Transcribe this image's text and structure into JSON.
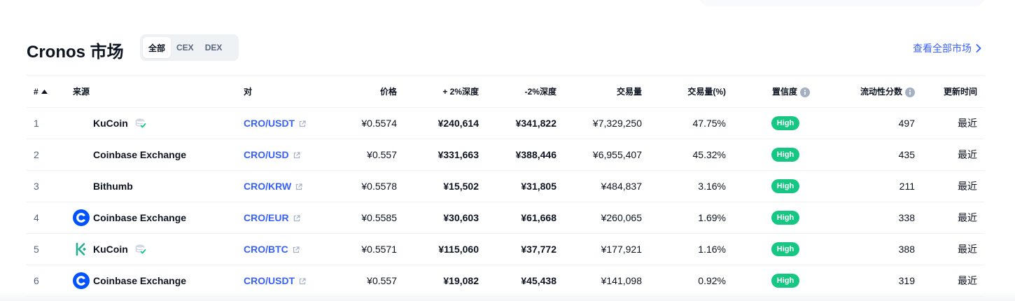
{
  "header": {
    "title": "Cronos 市场",
    "filters": [
      {
        "label": "全部",
        "active": true
      },
      {
        "label": "CEX",
        "active": false
      },
      {
        "label": "DEX",
        "active": false
      }
    ],
    "view_all": "查看全部市场"
  },
  "table": {
    "columns": {
      "rank": "#",
      "source": "来源",
      "pair": "对",
      "price": "价格",
      "depth_plus": "+ 2%深度",
      "depth_minus": "-2%深度",
      "volume": "交易量",
      "volume_pct": "交易量(%)",
      "confidence": "置信度",
      "liquidity": "流动性分数",
      "updated": "更新时间"
    },
    "rows": [
      {
        "rank": "1",
        "source": "KuCoin",
        "logo": "none",
        "verified": true,
        "pair": "CRO/USDT",
        "price": "¥0.5574",
        "depth_plus": "¥240,614",
        "depth_minus": "¥341,822",
        "volume": "¥7,329,250",
        "volume_pct": "47.75%",
        "confidence": "High",
        "liquidity": "497",
        "updated": "最近"
      },
      {
        "rank": "2",
        "source": "Coinbase Exchange",
        "logo": "none",
        "verified": false,
        "pair": "CRO/USD",
        "price": "¥0.557",
        "depth_plus": "¥331,663",
        "depth_minus": "¥388,446",
        "volume": "¥6,955,407",
        "volume_pct": "45.32%",
        "confidence": "High",
        "liquidity": "435",
        "updated": "最近"
      },
      {
        "rank": "3",
        "source": "Bithumb",
        "logo": "none",
        "verified": false,
        "pair": "CRO/KRW",
        "price": "¥0.5578",
        "depth_plus": "¥15,502",
        "depth_minus": "¥31,805",
        "volume": "¥484,837",
        "volume_pct": "3.16%",
        "confidence": "High",
        "liquidity": "211",
        "updated": "最近"
      },
      {
        "rank": "4",
        "source": "Coinbase Exchange",
        "logo": "coinbase",
        "verified": false,
        "pair": "CRO/EUR",
        "price": "¥0.5585",
        "depth_plus": "¥30,603",
        "depth_minus": "¥61,668",
        "volume": "¥260,065",
        "volume_pct": "1.69%",
        "confidence": "High",
        "liquidity": "338",
        "updated": "最近"
      },
      {
        "rank": "5",
        "source": "KuCoin",
        "logo": "kucoin",
        "verified": true,
        "pair": "CRO/BTC",
        "price": "¥0.5571",
        "depth_plus": "¥115,060",
        "depth_minus": "¥37,772",
        "volume": "¥177,921",
        "volume_pct": "1.16%",
        "confidence": "High",
        "liquidity": "388",
        "updated": "最近"
      },
      {
        "rank": "6",
        "source": "Coinbase Exchange",
        "logo": "coinbase",
        "verified": false,
        "pair": "CRO/USDT",
        "price": "¥0.557",
        "depth_plus": "¥19,082",
        "depth_minus": "¥45,438",
        "volume": "¥141,098",
        "volume_pct": "0.92%",
        "confidence": "High",
        "liquidity": "319",
        "updated": "最近"
      }
    ]
  },
  "colors": {
    "accent": "#3861fb",
    "high_badge": "#16c784",
    "coinbase": "#0052ff",
    "kucoin": "#23af91"
  },
  "icons": {
    "sort": "sort-up-icon",
    "info": "info-icon",
    "external": "external-link-icon",
    "verified": "verified-database-icon",
    "chevron": "chevron-right-icon"
  }
}
